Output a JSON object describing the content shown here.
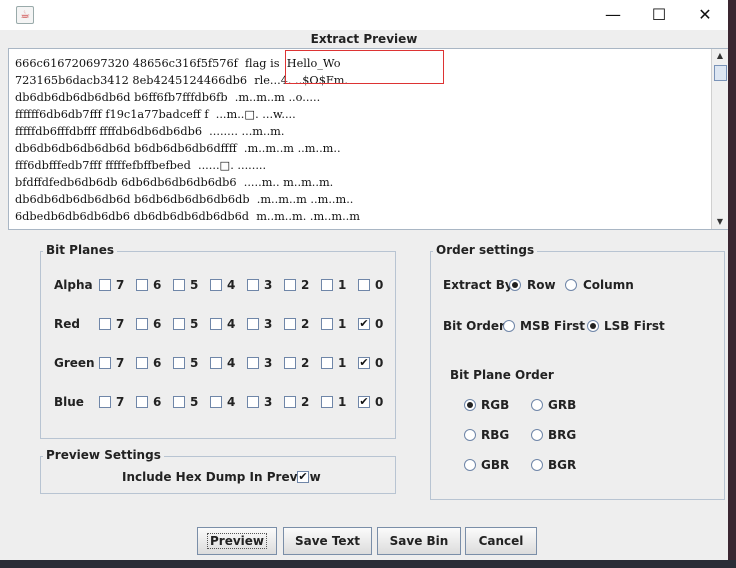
{
  "window": {
    "dialog_title": "Extract Preview",
    "minimize": "—",
    "maximize": "☐",
    "close": "✕",
    "app_icon": "java-icon"
  },
  "preview": {
    "lines": [
      "666c616720697320 48656c316f5f576f  flag is  Hello_Wo",
      "723165b6dacb3412 8eb4245124466db6  rle...4. ..$O$Fm.",
      "db6db6db6db6db6d b6ff6fb7fffdb6fb  .m..m..m ..o.....",
      "ffffff6db6db7fff f19c1a77badceff f  ...m..□. ...w....",
      "fffffdb6fffdbfff ffffdb6db6db6db6  ........ ...m..m.",
      "db6db6db6db6db6d b6db6db6db6dffff  .m..m..m ..m..m..",
      "fff6dbfffedb7fff fffffefbffbefbed  ......□. ........",
      "bfdffdfedb6db6db 6db6db6db6db6db6  .....m.. m..m..m.",
      "db6db6db6db6db6d b6db6db6db6db6db  .m..m..m ..m..m..",
      "6dbedb6db6db6db6 db6db6db6db6db6d  m..m..m. .m..m..m"
    ]
  },
  "bit_planes": {
    "title": "Bit Planes",
    "bits": [
      "7",
      "6",
      "5",
      "4",
      "3",
      "2",
      "1",
      "0"
    ],
    "rows": [
      {
        "label": "Alpha",
        "checked": [
          false,
          false,
          false,
          false,
          false,
          false,
          false,
          false
        ]
      },
      {
        "label": "Red",
        "checked": [
          false,
          false,
          false,
          false,
          false,
          false,
          false,
          true
        ]
      },
      {
        "label": "Green",
        "checked": [
          false,
          false,
          false,
          false,
          false,
          false,
          false,
          true
        ]
      },
      {
        "label": "Blue",
        "checked": [
          false,
          false,
          false,
          false,
          false,
          false,
          false,
          true
        ]
      }
    ]
  },
  "preview_settings": {
    "title": "Preview Settings",
    "include_hex_label": "Include Hex Dump In Preview",
    "include_hex_checked": true
  },
  "order_settings": {
    "title": "Order settings",
    "extract_by_label": "Extract By",
    "extract_by_options": [
      "Row",
      "Column"
    ],
    "extract_by_selected": "Row",
    "bit_order_label": "Bit Order",
    "bit_order_options": [
      "MSB First",
      "LSB First"
    ],
    "bit_order_selected": "LSB First",
    "plane_order_label": "Bit Plane Order",
    "plane_order_options": [
      "RGB",
      "GRB",
      "RBG",
      "BRG",
      "GBR",
      "BGR"
    ],
    "plane_order_selected": "RGB"
  },
  "buttons": {
    "preview": "Preview",
    "save_text": "Save Text",
    "save_bin": "Save Bin",
    "cancel": "Cancel"
  }
}
